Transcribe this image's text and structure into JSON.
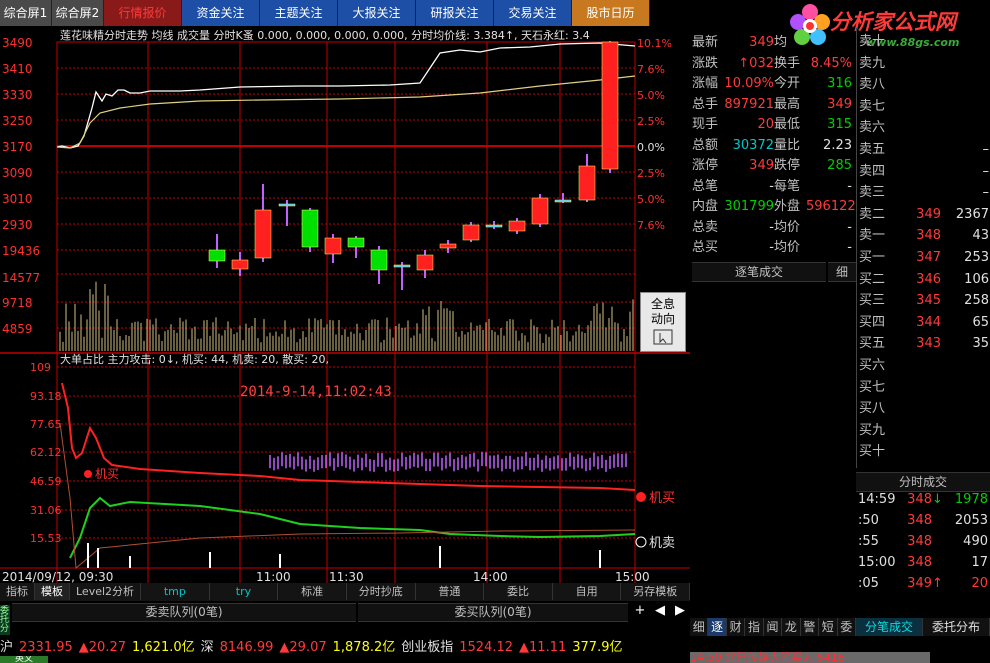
{
  "top_tabs": [
    {
      "label": "综合屏1",
      "style": "gray"
    },
    {
      "label": "综合屏2",
      "style": "gray"
    },
    {
      "label": "行情报价",
      "style": "red"
    },
    {
      "label": "资金关注",
      "style": "blue"
    },
    {
      "label": "主题关注",
      "style": "blue"
    },
    {
      "label": "大报关注",
      "style": "blue"
    },
    {
      "label": "研报关注",
      "style": "blue"
    },
    {
      "label": "交易关注",
      "style": "blue"
    },
    {
      "label": "股市日历",
      "style": "orange"
    }
  ],
  "logo": {
    "text": "分析家公式网",
    "url": "www.88gs.com"
  },
  "chart": {
    "header_text": "莲花味精分时走势 均线 成交量 分时K蚤 0.000, 0.000, 0.000, 0.000, 分时均价线: 3.384↑, 天石永红: 3.4",
    "price_ticks": [
      "3490",
      "3410",
      "3330",
      "3250",
      "3170",
      "3090",
      "3010",
      "2930"
    ],
    "pct_ticks": [
      "10.1%",
      "7.6%",
      "5.0%",
      "2.5%",
      "0.0%",
      "2.5%",
      "5.0%",
      "7.6%"
    ],
    "vol_ticks": [
      "19436",
      "14577",
      "9718",
      "4859"
    ],
    "sub_header": "大单占比 主力攻击: 0↓, 机买: 44, 机卖: 20, 散买: 20,",
    "sub_ticks": [
      "109",
      "93.18",
      "77.65",
      "62.12",
      "46.59",
      "31.06",
      "15.53"
    ],
    "datetime_annotation": "2014-9-14,11:02:43",
    "legend_buy": "机买",
    "legend_sell": "机卖",
    "legend_buy_small": "机买",
    "time_labels": [
      "2014/09/12, 09:30",
      "11:00",
      "11:30",
      "14:00",
      "15:00"
    ],
    "overlay_button": {
      "line1": "全息",
      "line2": "动向"
    }
  },
  "bottom_tabs": [
    "指标",
    "模板",
    "Level2分析",
    "tmp",
    "try",
    "标准",
    "分时抄底",
    "普通",
    "委比",
    "自用",
    "另存模板"
  ],
  "queue_bar": {
    "left": "委卖队列(0笔)",
    "right": "委买队列(0笔)",
    "plus": "+",
    "prev": "◀",
    "next": "▶",
    "minus": "−"
  },
  "quote": {
    "rows": [
      {
        "l1": "最新",
        "v1": "349",
        "l2": "均",
        "v2": ""
      },
      {
        "l1": "涨跌",
        "v1": "↑032",
        "l2": "换手",
        "v2": "8.45%"
      },
      {
        "l1": "涨幅",
        "v1": "10.09%",
        "l2": "今开",
        "v2": "316"
      },
      {
        "l1": "总手",
        "v1": "897921",
        "l2": "最高",
        "v2": "349"
      },
      {
        "l1": "现手",
        "v1": "20",
        "l2": "最低",
        "v2": "315"
      },
      {
        "l1": "总额",
        "v1": "30372",
        "l2": "量比",
        "v2": "2.23"
      },
      {
        "l1": "涨停",
        "v1": "349",
        "l2": "跌停",
        "v2": "285"
      },
      {
        "l1": "总笔",
        "v1": "-",
        "l2": "每笔",
        "v2": "-"
      },
      {
        "l1": "内盘",
        "v1": "301799",
        "l2": "外盘",
        "v2": "596122"
      },
      {
        "l1": "总卖",
        "v1": "-",
        "l2": "均价",
        "v2": "-"
      },
      {
        "l1": "总买",
        "v1": "-",
        "l2": "均价",
        "v2": "-"
      }
    ],
    "deal_header": "逐笔成交",
    "deal_header_tail": "细"
  },
  "book": {
    "sells": [
      {
        "label": "卖十",
        "price": "",
        "vol": ""
      },
      {
        "label": "卖九",
        "price": "",
        "vol": ""
      },
      {
        "label": "卖八",
        "price": "",
        "vol": ""
      },
      {
        "label": "卖七",
        "price": "",
        "vol": ""
      },
      {
        "label": "卖六",
        "price": "",
        "vol": ""
      },
      {
        "label": "卖五",
        "price": "",
        "vol": "–"
      },
      {
        "label": "卖四",
        "price": "",
        "vol": "–"
      },
      {
        "label": "卖三",
        "price": "",
        "vol": "–"
      },
      {
        "label": "卖二",
        "price": "349",
        "vol": "2367"
      },
      {
        "label": "卖一",
        "price": "348",
        "vol": "43"
      }
    ],
    "buys": [
      {
        "label": "买一",
        "price": "347",
        "vol": "253"
      },
      {
        "label": "买二",
        "price": "346",
        "vol": "106"
      },
      {
        "label": "买三",
        "price": "345",
        "vol": "258"
      },
      {
        "label": "买四",
        "price": "344",
        "vol": "65"
      },
      {
        "label": "买五",
        "price": "343",
        "vol": "35"
      },
      {
        "label": "买六",
        "price": "",
        "vol": ""
      },
      {
        "label": "买七",
        "price": "",
        "vol": ""
      },
      {
        "label": "买八",
        "price": "",
        "vol": ""
      },
      {
        "label": "买九",
        "price": "",
        "vol": ""
      },
      {
        "label": "买十",
        "price": "",
        "vol": ""
      }
    ],
    "ticks_header": "分时成交",
    "ticks": [
      {
        "time": "14:59",
        "price": "348",
        "arrow": "↓",
        "vol": "1978"
      },
      {
        "time": ":50",
        "price": "348",
        "arrow": "",
        "vol": "2053"
      },
      {
        "time": ":55",
        "price": "348",
        "arrow": "",
        "vol": "490"
      },
      {
        "time": "15:00",
        "price": "348",
        "arrow": "",
        "vol": "17"
      },
      {
        "time": ":05",
        "price": "349",
        "arrow": "↑",
        "vol": "20"
      }
    ]
  },
  "side_tabs": [
    "细",
    "逐",
    "财",
    "指",
    "闻",
    "龙",
    "警",
    "短",
    "委"
  ],
  "right_bottom_tabs": [
    "分笔成交",
    "委托分布"
  ],
  "ticker": {
    "items": [
      {
        "text": "沪",
        "cls": "wht"
      },
      {
        "text": "2331.95",
        "cls": "red"
      },
      {
        "text": "▲20.27",
        "cls": "red"
      },
      {
        "text": "1,621.0亿",
        "cls": "yel"
      },
      {
        "text": "深",
        "cls": "wht"
      },
      {
        "text": "8146.99",
        "cls": "red"
      },
      {
        "text": "▲29.07",
        "cls": "red"
      },
      {
        "text": "1,878.2亿",
        "cls": "yel"
      },
      {
        "text": "创业板指",
        "cls": "wht"
      },
      {
        "text": "1524.12",
        "cls": "red"
      },
      {
        "text": "▲11.11",
        "cls": "red"
      },
      {
        "text": "377.9亿",
        "cls": "yel"
      }
    ]
  },
  "status": {
    "left": "英文",
    "right_news": "14:50 北巴传媒大笔买入 5416"
  },
  "colors": {
    "grid": "#c00000",
    "price_line": "#ffffff",
    "avg_line": "#e0d080",
    "up": "#ff2020",
    "down": "#00e000",
    "volume": "#d0c080",
    "buy_line": "#ff2020",
    "sell_line": "#20d020"
  },
  "side_vertical_label": "委托分析"
}
